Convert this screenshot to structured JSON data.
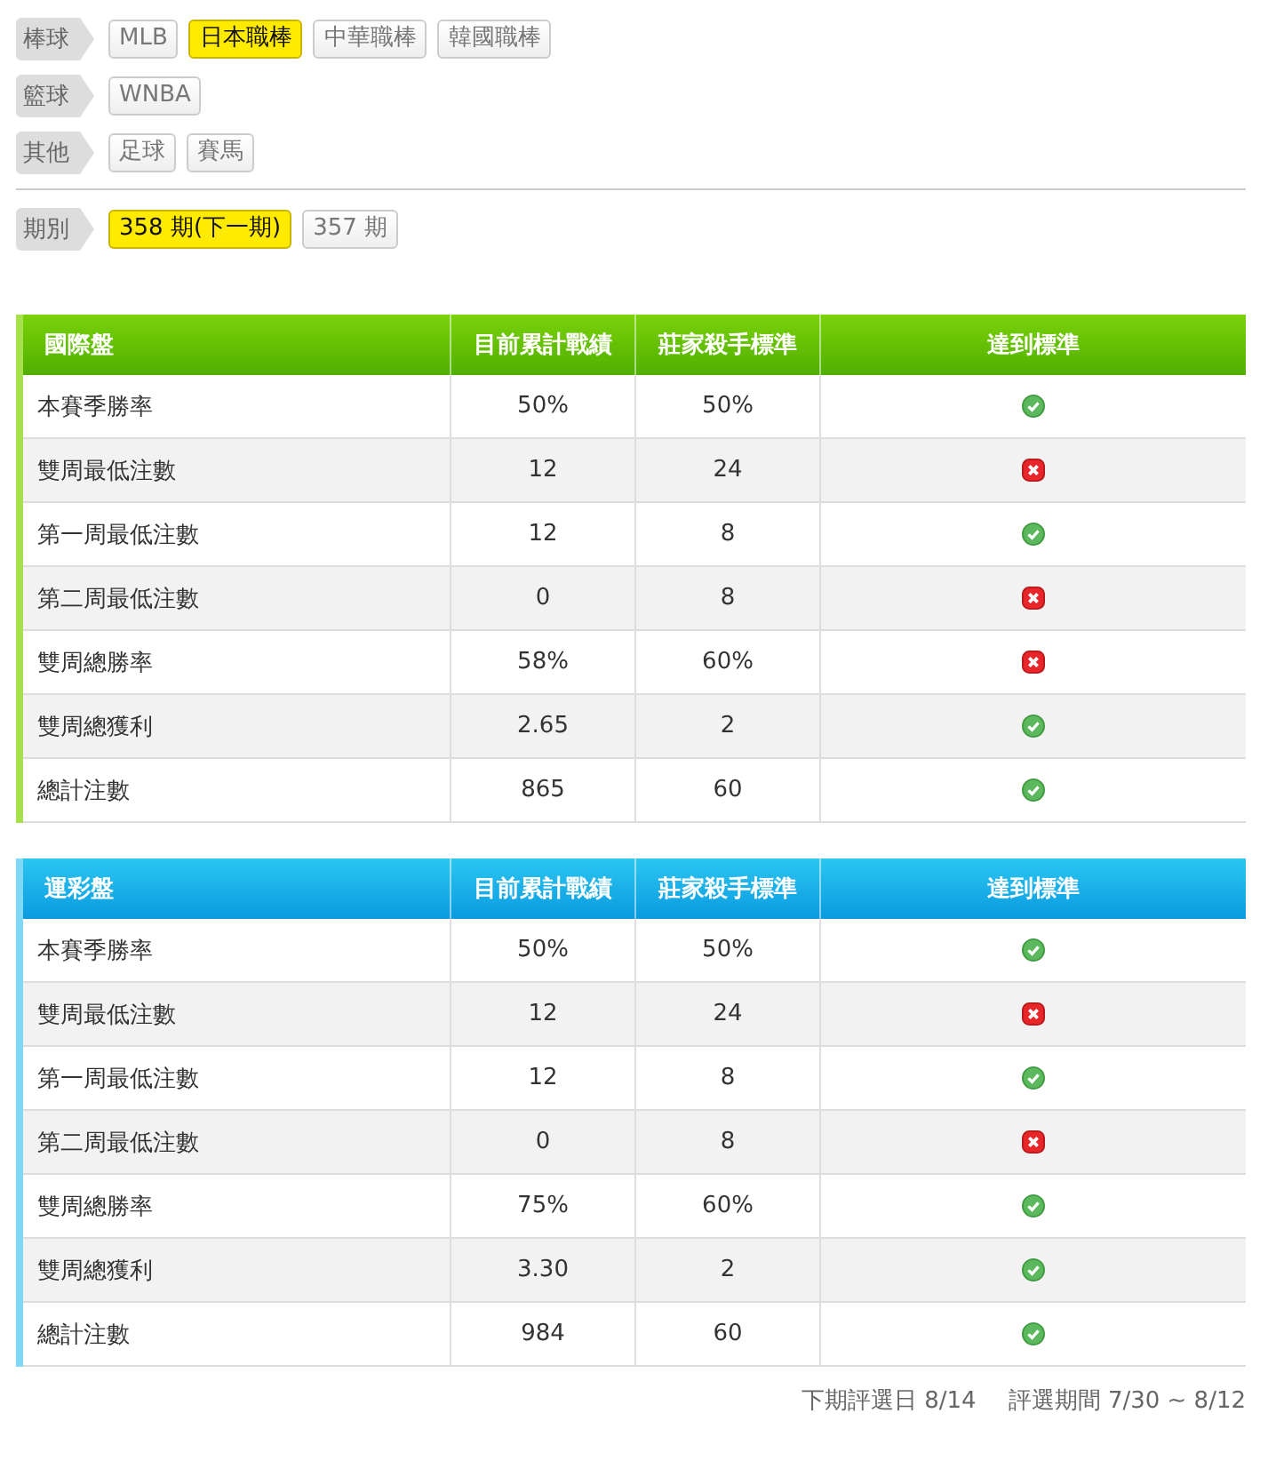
{
  "filters": [
    {
      "label": "棒球",
      "options": [
        {
          "label": "MLB",
          "selected": false
        },
        {
          "label": "日本職棒",
          "selected": true
        },
        {
          "label": "中華職棒",
          "selected": false
        },
        {
          "label": "韓國職棒",
          "selected": false
        }
      ]
    },
    {
      "label": "籃球",
      "options": [
        {
          "label": "WNBA",
          "selected": false
        }
      ]
    },
    {
      "label": "其他",
      "options": [
        {
          "label": "足球",
          "selected": false
        },
        {
          "label": "賽馬",
          "selected": false
        }
      ]
    }
  ],
  "period": {
    "label": "期別",
    "options": [
      {
        "label": "358 期(下一期)",
        "selected": true
      },
      {
        "label": "357 期",
        "selected": false
      }
    ]
  },
  "tables": [
    {
      "kind": "green",
      "columns": [
        "國際盤",
        "目前累計戰績",
        "莊家殺手標準",
        "達到標準"
      ],
      "rows": [
        {
          "label": "本賽季勝率",
          "current": "50%",
          "standard": "50%",
          "met": true
        },
        {
          "label": "雙周最低注數",
          "current": "12",
          "standard": "24",
          "met": false
        },
        {
          "label": "第一周最低注數",
          "current": "12",
          "standard": "8",
          "met": true
        },
        {
          "label": "第二周最低注數",
          "current": "0",
          "standard": "8",
          "met": false
        },
        {
          "label": "雙周總勝率",
          "current": "58%",
          "standard": "60%",
          "met": false
        },
        {
          "label": "雙周總獲利",
          "current": "2.65",
          "standard": "2",
          "met": true
        },
        {
          "label": "總計注數",
          "current": "865",
          "standard": "60",
          "met": true
        }
      ]
    },
    {
      "kind": "blue",
      "columns": [
        "運彩盤",
        "目前累計戰績",
        "莊家殺手標準",
        "達到標準"
      ],
      "rows": [
        {
          "label": "本賽季勝率",
          "current": "50%",
          "standard": "50%",
          "met": true
        },
        {
          "label": "雙周最低注數",
          "current": "12",
          "standard": "24",
          "met": false
        },
        {
          "label": "第一周最低注數",
          "current": "12",
          "standard": "8",
          "met": true
        },
        {
          "label": "第二周最低注數",
          "current": "0",
          "standard": "8",
          "met": false
        },
        {
          "label": "雙周總勝率",
          "current": "75%",
          "standard": "60%",
          "met": true
        },
        {
          "label": "雙周總獲利",
          "current": "3.30",
          "standard": "2",
          "met": true
        },
        {
          "label": "總計注數",
          "current": "984",
          "standard": "60",
          "met": true
        }
      ]
    }
  ],
  "footer": {
    "next_date": "下期評選日 8/14",
    "period": "評選期間 7/30 ~ 8/12"
  }
}
